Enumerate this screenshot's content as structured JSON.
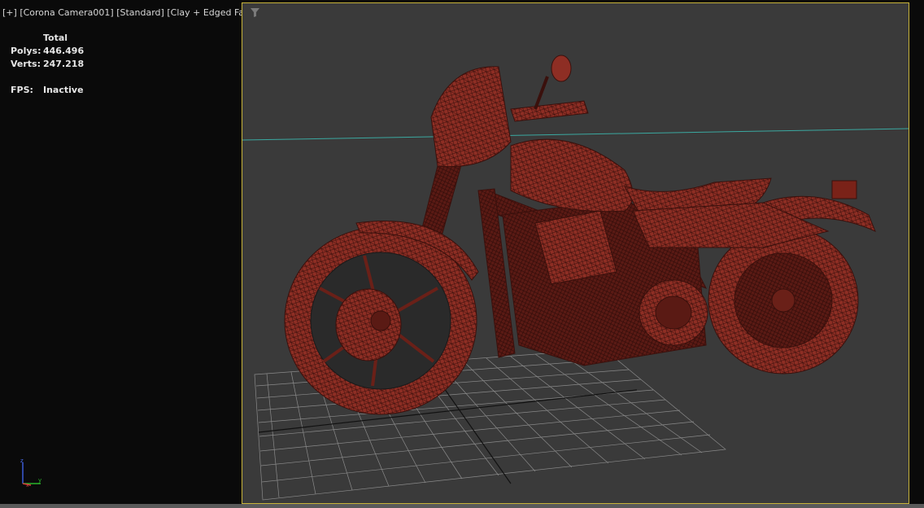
{
  "viewport": {
    "label_plus": "[+]",
    "label_camera": "[Corona Camera001]",
    "label_shading": "[Standard]",
    "label_style": "[Clay + Edged Faces]"
  },
  "stats": {
    "total_header": "Total",
    "polys_label": "Polys:",
    "polys_value": "446.496",
    "verts_label": "Verts:",
    "verts_value": "247.218",
    "fps_label": "FPS:",
    "fps_value": "Inactive"
  },
  "axis": {
    "z": "z",
    "y": "y",
    "x": "x"
  },
  "colors": {
    "viewport_bg": "#3a3a3a",
    "active_border": "#c8b43a",
    "model": "#8e2e24",
    "wire": "#3a100c",
    "horizon": "#3aa8a0"
  },
  "icons": {
    "filter": "filter-icon"
  }
}
